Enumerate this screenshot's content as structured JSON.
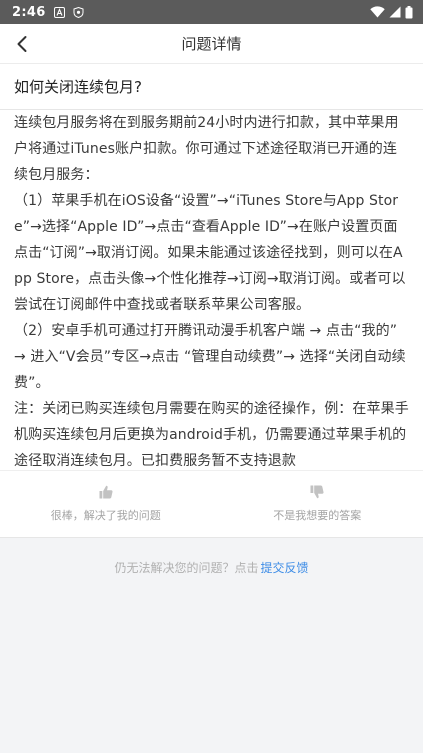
{
  "status": {
    "time": "2:46"
  },
  "header": {
    "title": "问题详情",
    "back_icon": "chevron-left-icon"
  },
  "question": {
    "title": "如何关闭连续包月?"
  },
  "answer": {
    "paragraphs": [
      "连续包月服务将在到服务期前24小时内进行扣款，其中苹果用户将通过iTunes账户扣款。你可通过下述途径取消已开通的连续包月服务：",
      "（1）苹果手机在iOS设备“设置”→“iTunes Store与App Store”→选择“Apple ID”→点击“查看Apple ID”→在账户设置页面点击“订阅”→取消订阅。如果未能通过该途径找到，则可以在App Store，点击头像→个性化推荐→订阅→取消订阅。或者可以尝试在订阅邮件中查找或者联系苹果公司客服。",
      "（2）安卓手机可通过打开腾讯动漫手机客户端 → 点击“我的” → 进入“V会员”专区→点击 “管理自动续费”→ 选择“关闭自动续费”。",
      "注：关闭已购买连续包月需要在购买的途径操作，例：在苹果手机购买连续包月后更换为android手机，仍需要通过苹果手机的途径取消连续包月。已扣费服务暂不支持退款"
    ]
  },
  "feedback": {
    "helpful_label": "很棒，解决了我的问题",
    "not_helpful_label": "不是我想要的答案",
    "helpful_icon": "thumbs-up-icon",
    "not_helpful_icon": "thumbs-down-icon"
  },
  "help": {
    "prompt": "仍无法解决您的问题？点击",
    "link_label": "提交反馈"
  },
  "colors": {
    "link": "#3d8ce6",
    "status_bar": "#5b5b5b"
  }
}
